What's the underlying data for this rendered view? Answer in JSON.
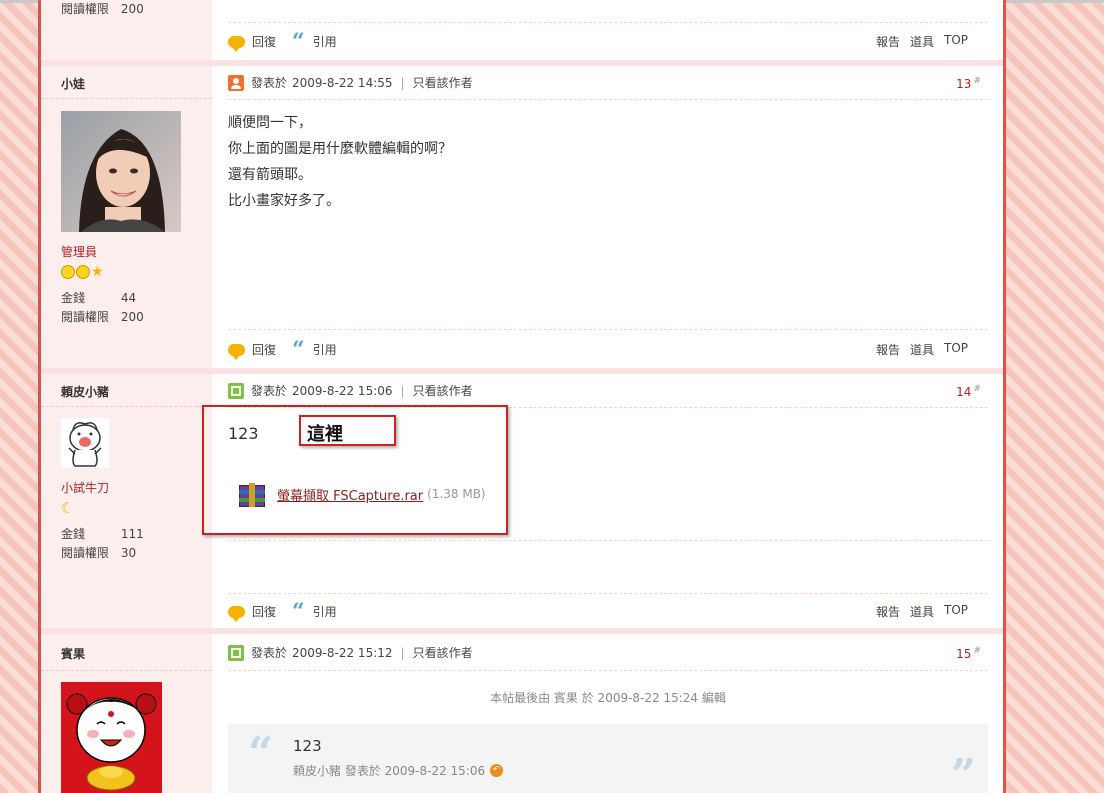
{
  "post0": {
    "stat_label": "閱讀權限",
    "stat_value": "200",
    "reply_label": "回復",
    "quote_label": "引用",
    "report_label": "報告",
    "tools_label": "道具",
    "top_label": "TOP"
  },
  "post13": {
    "author": "小娃",
    "rank": "管理員",
    "stats": [
      {
        "label": "金錢",
        "value": "44"
      },
      {
        "label": "閱讀權限",
        "value": "200"
      }
    ],
    "posted_prefix": "發表於",
    "date": "2009-8-22 14:55",
    "only_author": "只看該作者",
    "floor": "13",
    "floor_mark": "#",
    "lines": [
      "順便問一下，",
      "你上面的圖是用什麼軟體編輯的啊？",
      "還有箭頭耶。",
      "比小畫家好多了。"
    ],
    "reply_label": "回復",
    "quote_label": "引用",
    "report_label": "報告",
    "tools_label": "道具",
    "top_label": "TOP"
  },
  "post14": {
    "author": "頼皮小豬",
    "rank": "小試牛刀",
    "stats": [
      {
        "label": "金錢",
        "value": "111"
      },
      {
        "label": "閱讀權限",
        "value": "30"
      }
    ],
    "posted_prefix": "發表於",
    "date": "2009-8-22 15:06",
    "only_author": "只看該作者",
    "floor": "14",
    "floor_mark": "#",
    "body_text": "123",
    "callout": "這裡",
    "attachment_name": "螢幕擷取 FSCapture.rar",
    "attachment_size": "(1.38 MB)",
    "reply_label": "回復",
    "quote_label": "引用",
    "report_label": "報告",
    "tools_label": "道具",
    "top_label": "TOP"
  },
  "post15": {
    "author": "賓果",
    "posted_prefix": "發表於",
    "date": "2009-8-22 15:12",
    "only_author": "只看該作者",
    "floor": "15",
    "floor_mark": "#",
    "edit_note": "本帖最後由 賓果 於 2009-8-22 15:24 編輯",
    "quote_text": "123",
    "quote_meta": "頼皮小豬 發表於 2009-8-22 15:06"
  },
  "colors": {
    "accent": "#d9534f",
    "link": "#8b2020",
    "floor": "#b22222",
    "sidebar_bg": "#fdeeee"
  }
}
